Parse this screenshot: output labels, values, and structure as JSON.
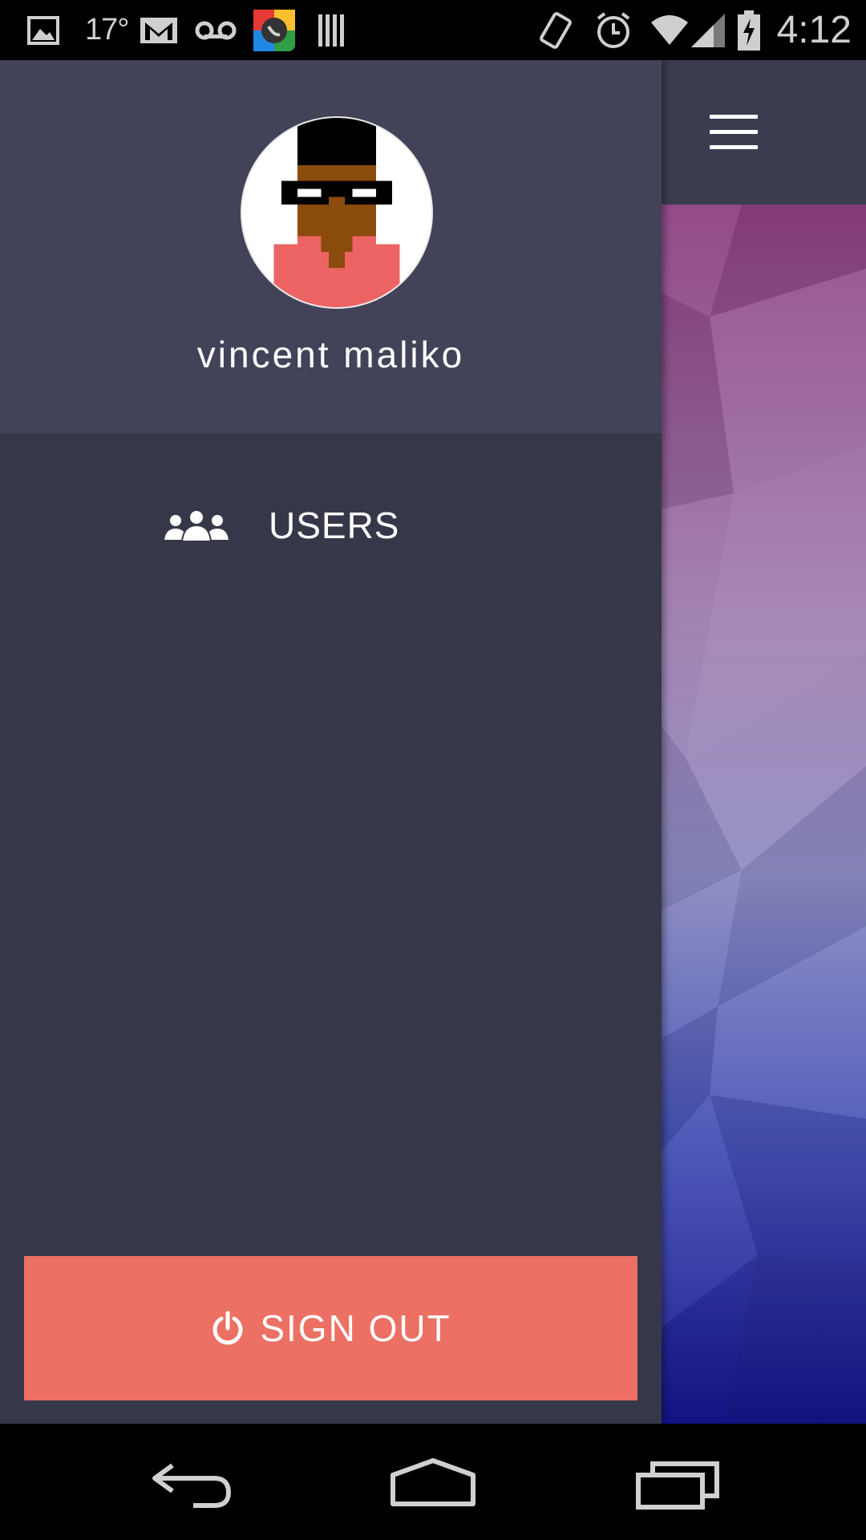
{
  "status_bar": {
    "temperature": "17°",
    "time": "4:12",
    "icons": [
      "image-icon",
      "gmail-icon",
      "voicemail-icon",
      "hangouts-icon",
      "barcode-icon",
      "vibrate-icon",
      "alarm-icon",
      "wifi-icon",
      "signal-icon",
      "battery-charging-icon"
    ]
  },
  "drawer": {
    "user_name": "vincent maliko",
    "nav_items": [
      {
        "label": "USERS",
        "icon": "users-icon"
      }
    ],
    "sign_out_label": "SIGN OUT"
  },
  "toolbar": {
    "menu_icon": "hamburger-menu-icon"
  },
  "nav_bar": {
    "buttons": [
      "back-icon",
      "home-icon",
      "recents-icon"
    ]
  },
  "colors": {
    "drawer_bg": "#37374a",
    "drawer_header_bg": "#424358",
    "sign_out_bg": "#ec7063",
    "toolbar_bg": "#3b3c50"
  }
}
